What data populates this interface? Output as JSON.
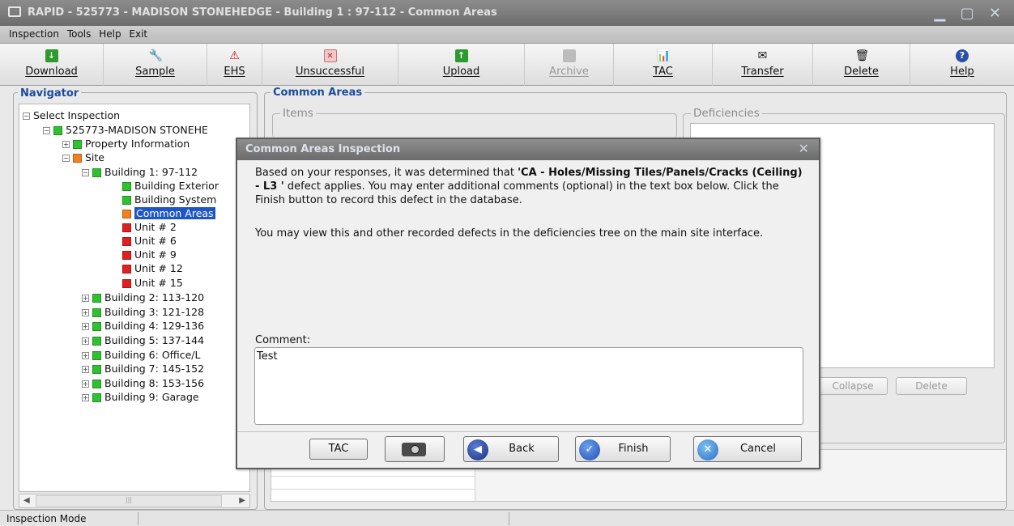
{
  "window": {
    "title": "RAPID - 525773 - MADISON STONEHEDGE - Building 1   : 97-112 - Common Areas"
  },
  "menu": [
    "Inspection",
    "Tools",
    "Help",
    "Exit"
  ],
  "toolbar": [
    {
      "label": "Download",
      "icon": "download-icon",
      "enabled": true
    },
    {
      "label": "Sample",
      "icon": "sample-icon",
      "enabled": true
    },
    {
      "label": "EHS",
      "icon": "warning-icon",
      "enabled": true
    },
    {
      "label": "Unsuccessful",
      "icon": "unsuccessful-icon",
      "enabled": true
    },
    {
      "label": "Upload",
      "icon": "upload-icon",
      "enabled": true
    },
    {
      "label": "Archive",
      "icon": "archive-icon",
      "enabled": false
    },
    {
      "label": "TAC",
      "icon": "tac-icon",
      "enabled": true
    },
    {
      "label": "Transfer",
      "icon": "transfer-icon",
      "enabled": true
    },
    {
      "label": "Delete",
      "icon": "delete-icon",
      "enabled": true
    },
    {
      "label": "Help",
      "icon": "help-icon",
      "enabled": true
    }
  ],
  "navigator": {
    "title": "Navigator",
    "tree": [
      {
        "label": "Select Inspection",
        "status": "none",
        "expander": "−"
      },
      {
        "label": "525773-MADISON STONEHE",
        "status": "green",
        "expander": "−"
      },
      {
        "label": "Property Information",
        "status": "green",
        "expander": "+"
      },
      {
        "label": "Site",
        "status": "orange",
        "expander": "−"
      },
      {
        "label": "Building 1: 97-112",
        "status": "green",
        "expander": "−"
      },
      {
        "label": "Building Exterior",
        "status": "green",
        "expander": ""
      },
      {
        "label": "Building System",
        "status": "green",
        "expander": ""
      },
      {
        "label": "Common Areas",
        "status": "orange",
        "expander": "",
        "selected": true
      },
      {
        "label": "Unit # 2",
        "status": "red",
        "expander": ""
      },
      {
        "label": "Unit # 6",
        "status": "red",
        "expander": ""
      },
      {
        "label": "Unit # 9",
        "status": "red",
        "expander": ""
      },
      {
        "label": "Unit # 12",
        "status": "red",
        "expander": ""
      },
      {
        "label": "Unit # 15",
        "status": "red",
        "expander": ""
      },
      {
        "label": "Building 2: 113-120",
        "status": "green",
        "expander": "+"
      },
      {
        "label": "Building 3: 121-128",
        "status": "green",
        "expander": "+"
      },
      {
        "label": "Building 4: 129-136",
        "status": "green",
        "expander": "+"
      },
      {
        "label": "Building 5: 137-144",
        "status": "green",
        "expander": "+"
      },
      {
        "label": "Building 6: Office/L",
        "status": "green",
        "expander": "+"
      },
      {
        "label": "Building 7: 145-152",
        "status": "green",
        "expander": "+"
      },
      {
        "label": "Building 8: 153-156",
        "status": "green",
        "expander": "+"
      },
      {
        "label": "Building 9: Garage",
        "status": "green",
        "expander": "+"
      }
    ]
  },
  "main": {
    "title": "Common Areas",
    "items_label": "Items",
    "deficiencies_label": "Deficiencies",
    "collapse_label": "Collapse",
    "delete_label": "Delete"
  },
  "dialog": {
    "title": "Common Areas Inspection",
    "msg_prefix": "Based on your responses, it was determined that ",
    "defect": "'CA - Holes/Missing Tiles/Panels/Cracks (Ceiling) - L3 '",
    "msg_suffix": " defect applies. You may enter additional comments (optional) in the text box below. Click the Finish button to record this defect in the database.",
    "msg2": "You may view this and other recorded defects in the deficiencies tree on the main site interface.",
    "comment_label": "Comment:",
    "comment_value": "Test",
    "buttons": {
      "tac": "TAC",
      "back": "Back",
      "finish": "Finish",
      "cancel": "Cancel"
    }
  },
  "status": {
    "mode": "Inspection Mode"
  },
  "colors": {
    "accent": "#1c4c9c",
    "selection": "#1e56c5",
    "status_green": "#2fc12f",
    "status_orange": "#f08020",
    "status_red": "#e02020"
  }
}
